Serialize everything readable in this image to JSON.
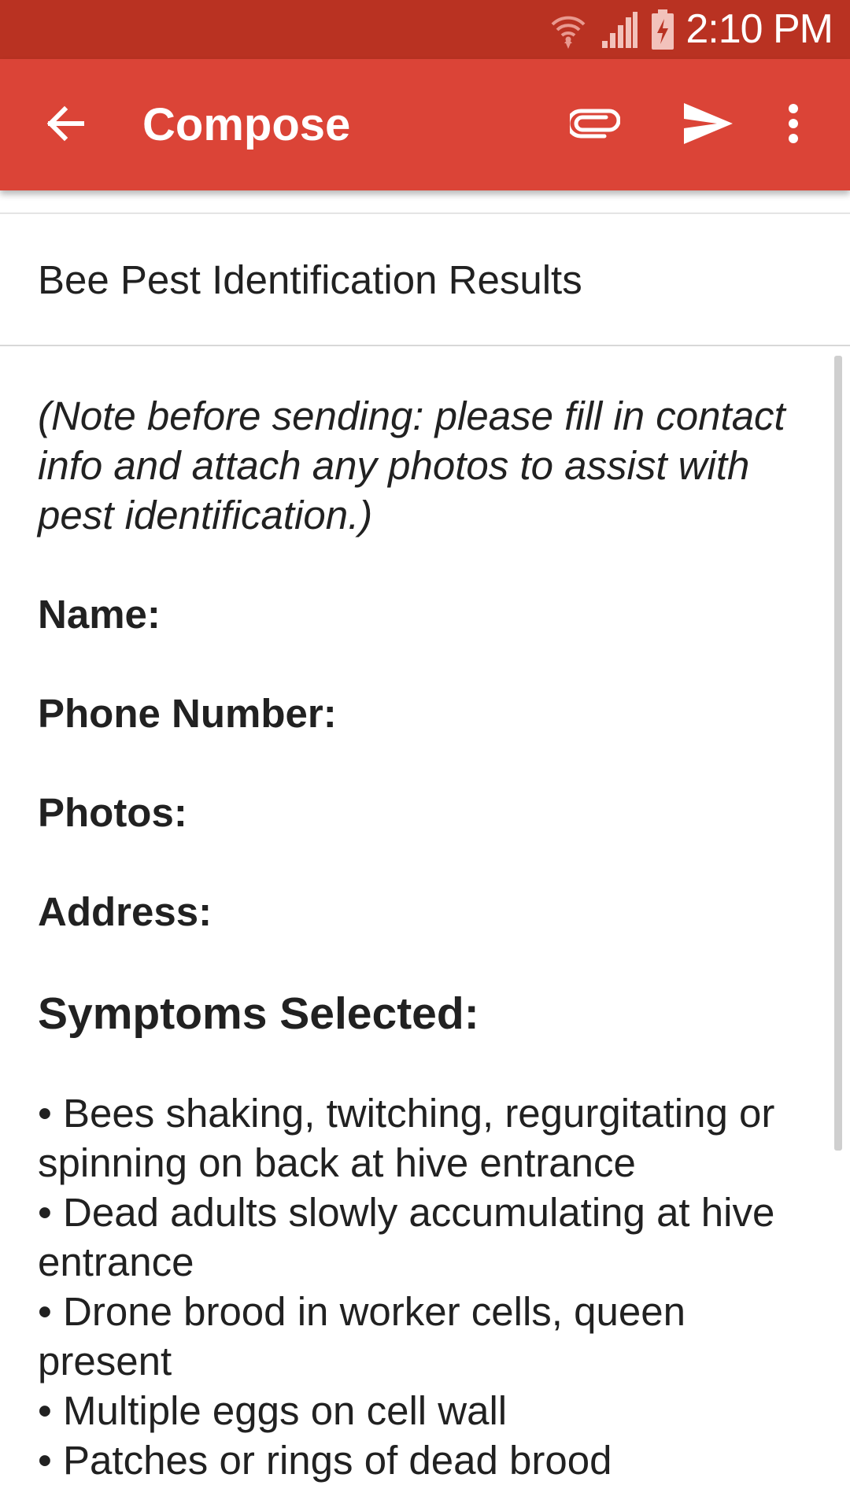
{
  "status_bar": {
    "time": "2:10 PM",
    "icons": [
      "wifi-icon",
      "signal-icon",
      "battery-charging-icon"
    ]
  },
  "app_bar": {
    "title": "Compose",
    "icons": [
      "back-arrow-icon",
      "paperclip-icon",
      "send-icon",
      "more-vertical-icon"
    ]
  },
  "subject": {
    "value": "Bee Pest Identification Results"
  },
  "body": {
    "note": "(Note before sending: please fill in contact info and attach any photos to assist with pest identification.)",
    "fields": [
      {
        "label": "Name:"
      },
      {
        "label": "Phone Number:"
      },
      {
        "label": "Photos:"
      },
      {
        "label": "Address:"
      }
    ],
    "symptoms_heading": "Symptoms Selected:",
    "symptoms": [
      "• Bees shaking, twitching, regurgitating or spinning on back at hive entrance",
      "• Dead adults slowly accumulating at hive entrance",
      "• Drone brood in worker cells, queen present",
      "• Multiple eggs on cell wall",
      "• Patches or rings of dead brood"
    ]
  },
  "colors": {
    "status_bar": "#b93222",
    "app_bar": "#db4437",
    "text": "#212121"
  }
}
